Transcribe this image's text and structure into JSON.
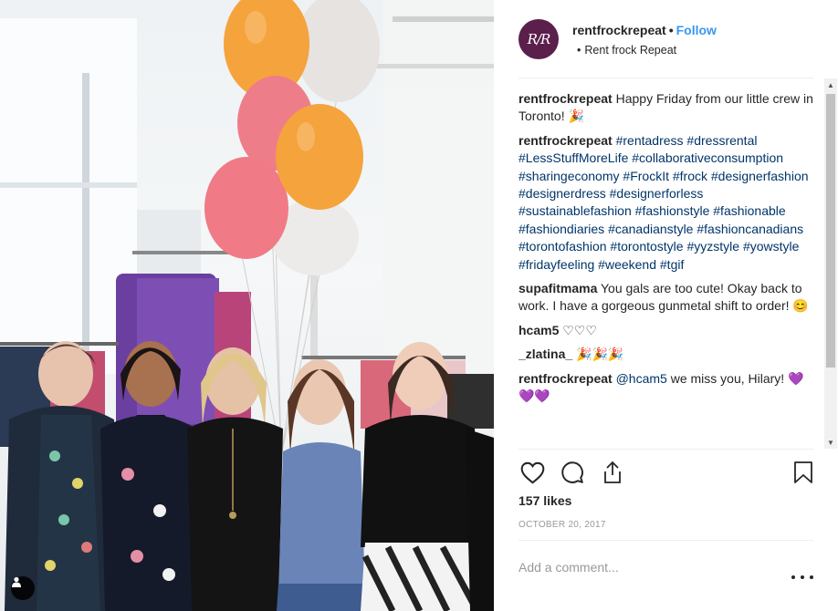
{
  "post": {
    "username": "rentfrockrepeat",
    "follow_label": "Follow",
    "location": "Rent frock Repeat",
    "avatar_text": "R/R",
    "caption": {
      "username": "rentfrockrepeat",
      "text": "Happy Friday from our little crew in Toronto! 🎉"
    },
    "hashtag_comment": {
      "username": "rentfrockrepeat",
      "tags": [
        "#rentadress",
        "#dressrental",
        "#LessStuffMoreLife",
        "#collaborativeconsumption",
        "#sharingeconomy",
        "#FrockIt",
        "#frock",
        "#designerfashion",
        "#designerdress",
        "#designerforless",
        "#sustainablefashion",
        "#fashionstyle",
        "#fashionable",
        "#fashiondiaries",
        "#canadianstyle",
        "#fashioncanadians",
        "#torontofashion",
        "#torontostyle",
        "#yyzstyle",
        "#yowstyle",
        "#fridayfeeling",
        "#weekend",
        "#tgif"
      ]
    },
    "comments": [
      {
        "username": "supafitmama",
        "text": "You gals are too cute! Okay back to work. I have a gorgeous gunmetal shift to order! 😊"
      },
      {
        "username": "hcam5",
        "text": "♡♡♡"
      },
      {
        "username": "_zlatina_",
        "text": "🎉🎉🎉"
      },
      {
        "username": "rentfrockrepeat",
        "mention": "@hcam5",
        "text": "we miss you, Hilary! 💜💜💜"
      }
    ],
    "likes": "157 likes",
    "date": "October 20, 2017",
    "add_comment_placeholder": "Add a comment..."
  },
  "icons": {
    "like": "heart-icon",
    "comment": "comment-icon",
    "share": "share-icon",
    "save": "bookmark-icon",
    "more": "more-options-icon",
    "user_tag": "user-tag-icon"
  },
  "colors": {
    "brand_avatar": "#5b1f4c",
    "follow": "#3897f0",
    "hashtag": "#003569",
    "balloon_orange": "#f5a33c",
    "balloon_pink": "#f07a86",
    "balloon_white": "#e9e6e4"
  }
}
